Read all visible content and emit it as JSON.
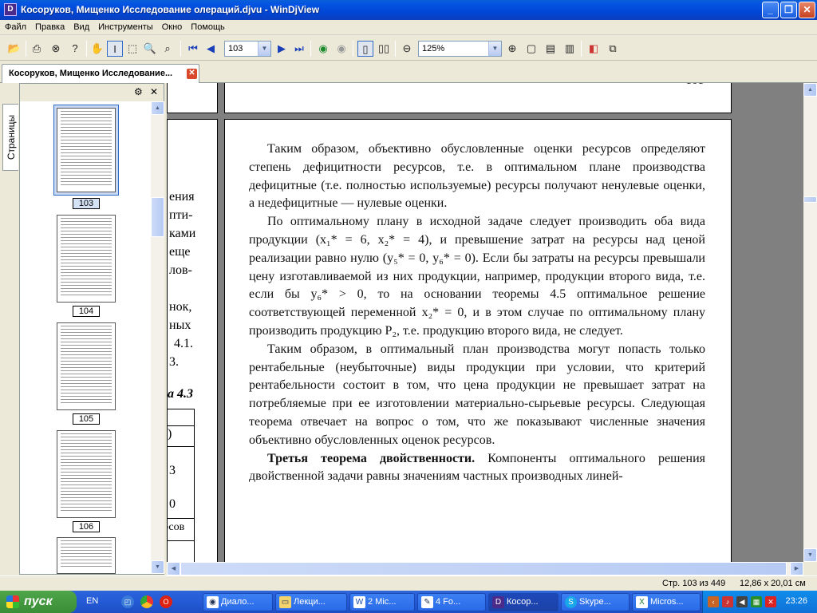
{
  "window": {
    "title": "Косоруков, Мищенко Исследование олераций.djvu - WinDjView",
    "icon": "windjview-app-icon"
  },
  "menu": [
    "Файл",
    "Правка",
    "Вид",
    "Инструменты",
    "Окно",
    "Помощь"
  ],
  "toolbar": {
    "page_value": "103",
    "zoom_value": "125%"
  },
  "tab": {
    "label": "Косоруков, Мищенко Исследование...",
    "close": "✕"
  },
  "sidebar": {
    "tab_label": "Страницы",
    "thumbs": [
      "103",
      "104",
      "105",
      "106"
    ]
  },
  "leftpage_fragments": [
    "ения",
    "пти-",
    "ками",
    "еще",
    "лов-",
    "нок,",
    "ных",
    "4.1.",
    "3.",
    "а 4.3",
    ")",
    "3",
    "0",
    "осов"
  ],
  "top_page_number": "101",
  "doc": {
    "p1": "Таким образом, объективно обусловленные оценки ресурсов определяют степень дефицитности ресурсов, т.е. в оптимальном плане производства дефицитные (т.е. полностью используемые) ресурсы получают ненулевые оценки, а недефицитные — нулевые оценки.",
    "p2": "По оптимальному плану в исходной задаче следует производить оба вида продукции (x₁* = 6, x₂* = 4), и превышение затрат на ресурсы над ценой реализации равно нулю (y₅* = 0, y₆* = 0). Если бы затраты на ресурсы превышали цену изготавливаемой из них продукции, например, продукции второго вида, т.е. если бы y₆* > 0, то на основании теоремы 4.5 оптимальное решение соответствующей переменной x₂* = 0, и в этом случае по оптимальному плану производить продукцию P₂, т.е. продукцию второго вида, не следует.",
    "p3": "Таким образом, в оптимальный план производства могут попасть только рентабельные (неубыточные) виды продукции при условии, что критерий рентабельности состоит в том, что цена продукции не превышает затрат на потребляемые при ее изготовлении материально-сырьевые ресурсы. Следующая теорема отвечает на вопрос о том, что же показывают численные значения объективно обусловленных оценок ресурсов.",
    "p4_bold": "Третья теорема двойственности.",
    "p4": " Компоненты оптимального решения двойственной задачи равны значениям частных производных линей-"
  },
  "status": {
    "page": "Стр. 103 из 449",
    "size": "12,86 x 20,01 см"
  },
  "taskbar": {
    "start": "пуск",
    "lang": "EN",
    "clock": "23:26",
    "buttons": [
      "Диало...",
      "Лекци...",
      "2 Mic...",
      "4 Fo...",
      "Косор...",
      "Skype...",
      "Micros..."
    ]
  }
}
